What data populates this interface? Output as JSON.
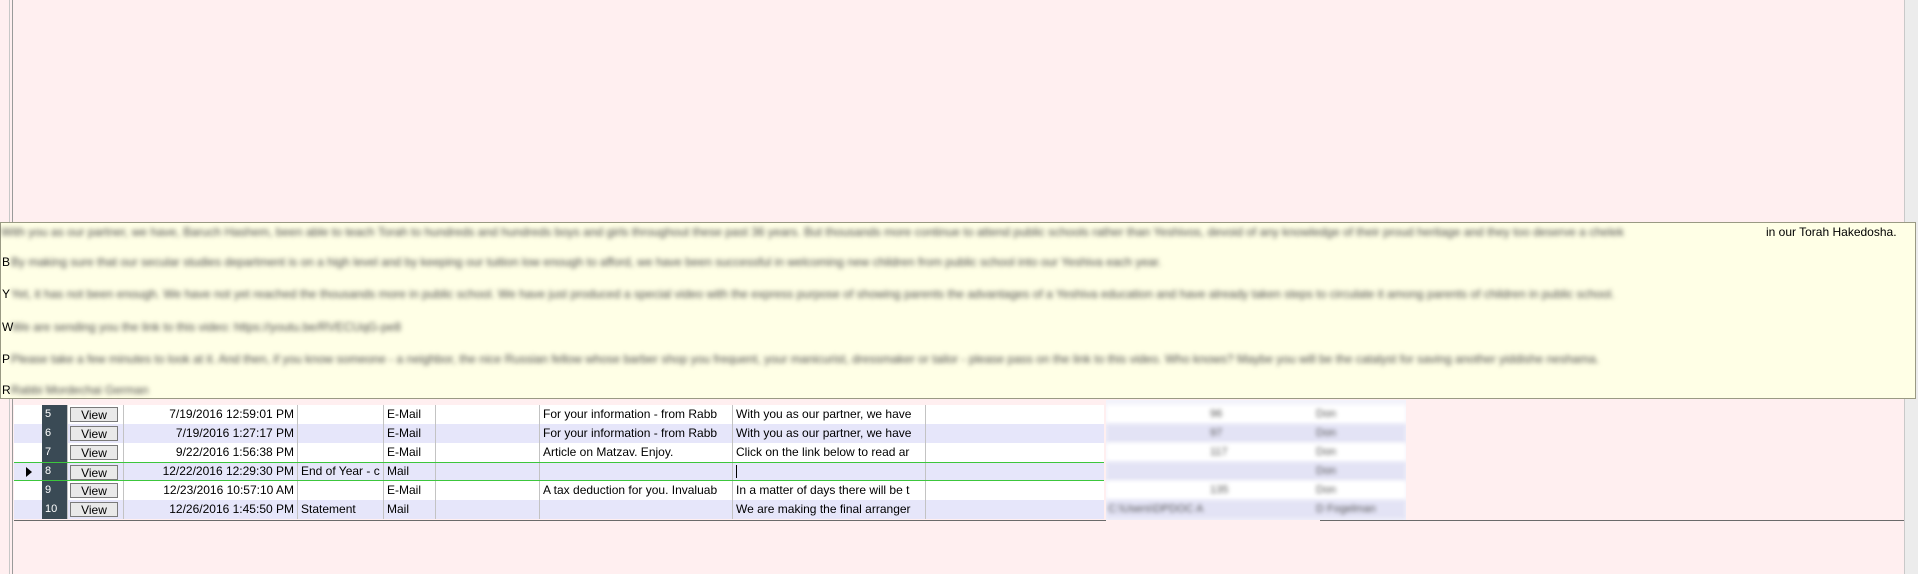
{
  "grid": {
    "view_label": "View",
    "rows": [
      {
        "num": "5",
        "date": "7/19/2016 12:59:01 PM",
        "title": "",
        "type": "E-Mail",
        "blank": "",
        "subject": "For your information - from Rabb",
        "body": "With you as our partner, we have",
        "style": "plain"
      },
      {
        "num": "6",
        "date": "7/19/2016 1:27:17 PM",
        "title": "",
        "type": "E-Mail",
        "blank": "",
        "subject": "For your information - from Rabb",
        "body": "With you as our partner, we have",
        "style": "alt"
      },
      {
        "num": "7",
        "date": "9/22/2016 1:56:38 PM",
        "title": "",
        "type": "E-Mail",
        "blank": "",
        "subject": "Article on Matzav.  Enjoy.",
        "body": "Click on the link below to read ar",
        "style": "plain"
      },
      {
        "num": "8",
        "date": "12/22/2016 12:29:30 PM",
        "title": "End of Year - c",
        "type": "Mail",
        "blank": "",
        "subject": "",
        "body": "",
        "style": "current"
      },
      {
        "num": "9",
        "date": "12/23/2016 10:57:10 AM",
        "title": "",
        "type": "E-Mail",
        "blank": "",
        "subject": "A tax deduction for you. Invaluab",
        "body": "In a matter of days there will be t",
        "style": "plain"
      },
      {
        "num": "10",
        "date": "12/26/2016 1:45:50 PM",
        "title": "Statement",
        "type": "Mail",
        "blank": "",
        "subject": "",
        "body": "We are making the final arranger",
        "style": "alt"
      }
    ]
  },
  "tooltip": {
    "line1_blurred": "With you as our partner, we have, Baruch Hashem, been able to teach Torah to hundreds and hundreds boys and girls throughout these past 36 years.  But thousands more continue to attend public schools rather than Yeshivos, devoid of any knowledge of their proud heritage and they too deserve a chelek",
    "line1_sharp": "in our Torah Hakedosha.",
    "line2_first": "B",
    "line2_blurred": "By making sure that our secular studies department is on a high level and by keeping our tuition low enough to afford, we have been successful in welcoming new children from public school into our Yeshiva each year.",
    "line3_first": "Y",
    "line3_blurred": "Yet, it has not been enough.  We have not yet reached the thousands more in public school.  We have just produced a special video with the express purpose of showing parents the advantages of a Yeshiva education and have already taken steps to circulate it among parents of children in public school.",
    "line4_first": "W",
    "line4_blurred": "We are sending you the link to this video:  https://youtu.be/RVECUqG-pe8",
    "line5_first": "P",
    "line5_blurred": "Please take a few minutes to look at it.  And then, if you know someone - a neighbor, the nice Russian fellow whose barber shop you frequent, your manicurist, dressmaker or tailor - please pass on the link to this video.  Who knows?  Maybe you will be the catalyst for saving another yiddishe neshama.",
    "line6_first": "R",
    "line6_blurred": "Rabbi Mordechai German"
  },
  "blurred_columns": {
    "rows": [
      {
        "a": "96",
        "b": "Don"
      },
      {
        "a": "97",
        "b": "Don"
      },
      {
        "a": "117",
        "b": "Don"
      },
      {
        "a": "",
        "b": "Don"
      },
      {
        "a": "135",
        "b": "Don"
      },
      {
        "a": "C:\\Users\\DPDOC A",
        "b": "D Fogelman"
      }
    ]
  }
}
